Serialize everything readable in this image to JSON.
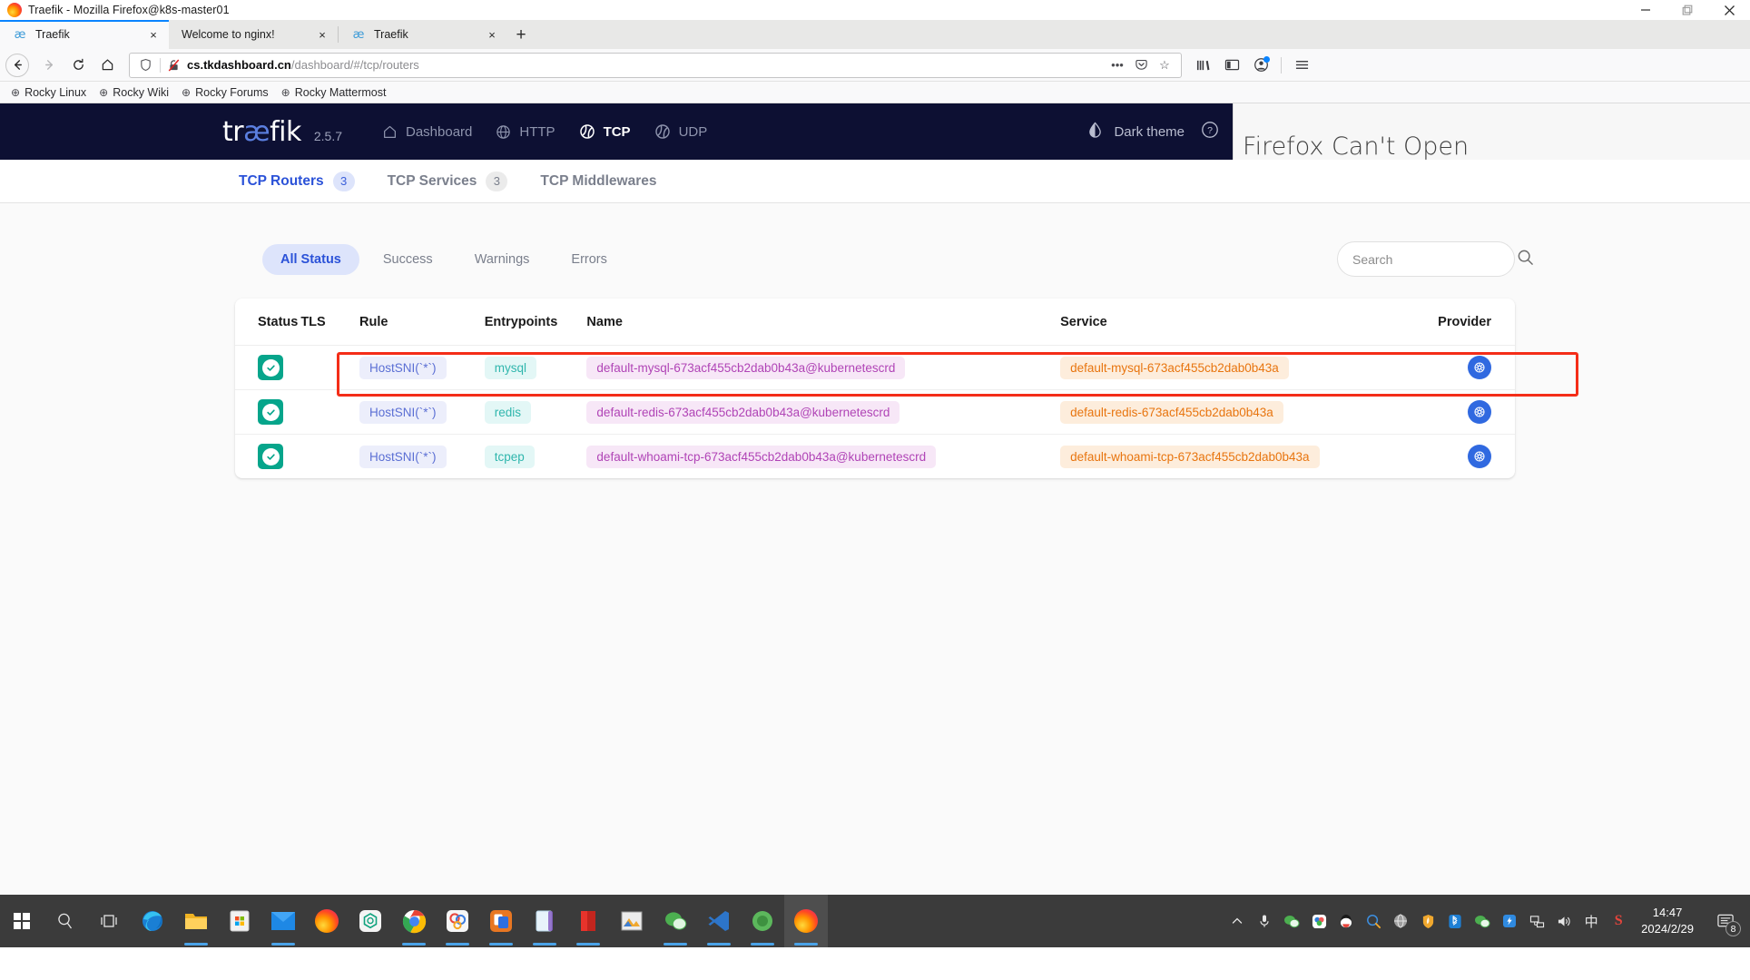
{
  "window": {
    "title": "Traefik - Mozilla Firefox@k8s-master01",
    "controls": {
      "minimize": "minimize-icon",
      "maximize": "restore-icon",
      "close": "close-icon"
    }
  },
  "tabs": [
    {
      "title": "Traefik",
      "favicon": "traefik-ae-icon",
      "active": true,
      "close": "×"
    },
    {
      "title": "Welcome to nginx!",
      "favicon": "",
      "active": false,
      "close": "×"
    },
    {
      "title": "Traefik",
      "favicon": "traefik-ae-icon",
      "active": false,
      "close": "×"
    }
  ],
  "newtab_label": "+",
  "toolbar": {
    "back": "back-icon",
    "forward": "forward-icon",
    "reload": "reload-icon",
    "home": "home-icon",
    "url_host": "cs.tkdashboard.cn",
    "url_path": "/dashboard/#/tcp/routers",
    "url_prefix": "",
    "page_actions": "•••",
    "pocket": "pocket-icon",
    "bookmark_star": "☆",
    "library": "library-icon",
    "sidebar": "sidebar-icon",
    "account": "account-icon",
    "menu": "hamburger-menu-icon"
  },
  "bookmarks": [
    {
      "label": "Rocky Linux",
      "icon": "⊕"
    },
    {
      "label": "Rocky Wiki",
      "icon": "⊕"
    },
    {
      "label": "Rocky Forums",
      "icon": "⊕"
    },
    {
      "label": "Rocky Mattermost",
      "icon": "⊕"
    }
  ],
  "traefik": {
    "logo_prefix": "tr",
    "logo_ae": "æ",
    "logo_suffix": "fik",
    "version": "2.5.7",
    "nav": [
      {
        "label": "Dashboard",
        "icon": "home-icon",
        "active": false
      },
      {
        "label": "HTTP",
        "icon": "globe-icon",
        "active": false
      },
      {
        "label": "TCP",
        "icon": "tcp-icon",
        "active": true
      },
      {
        "label": "UDP",
        "icon": "udp-icon",
        "active": false
      }
    ],
    "theme_label": "Dark theme",
    "help_label": "?",
    "subtabs": [
      {
        "label": "TCP Routers",
        "count": "3",
        "active": true
      },
      {
        "label": "TCP Services",
        "count": "3",
        "active": false
      },
      {
        "label": "TCP Middlewares",
        "count": "",
        "active": false
      }
    ],
    "status_filters": [
      {
        "label": "All Status",
        "active": true
      },
      {
        "label": "Success",
        "active": false
      },
      {
        "label": "Warnings",
        "active": false
      },
      {
        "label": "Errors",
        "active": false
      }
    ],
    "search": {
      "placeholder": "Search",
      "value": ""
    },
    "table": {
      "headers": [
        "Status",
        "TLS",
        "Rule",
        "Entrypoints",
        "Name",
        "Service",
        "Provider"
      ],
      "rows": [
        {
          "status": "success",
          "tls": "",
          "rule": "HostSNI(`*`)",
          "entrypoints": "mysql",
          "name": "default-mysql-673acf455cb2dab0b43a@kubernetescrd",
          "service": "default-mysql-673acf455cb2dab0b43a",
          "provider": "kubernetes-icon",
          "highlighted": false
        },
        {
          "status": "success",
          "tls": "",
          "rule": "HostSNI(`*`)",
          "entrypoints": "redis",
          "name": "default-redis-673acf455cb2dab0b43a@kubernetescrd",
          "service": "default-redis-673acf455cb2dab0b43a",
          "provider": "kubernetes-icon",
          "highlighted": true
        },
        {
          "status": "success",
          "tls": "",
          "rule": "HostSNI(`*`)",
          "entrypoints": "tcpep",
          "name": "default-whoami-tcp-673acf455cb2dab0b43a@kubernetescrd",
          "service": "default-whoami-tcp-673acf455cb2dab0b43a",
          "provider": "kubernetes-icon",
          "highlighted": false
        }
      ]
    }
  },
  "firefox_overlay": {
    "text": "Firefox Can't Open"
  },
  "taskbar": {
    "start": "windows-start-icon",
    "search": "search-icon",
    "taskview": "task-view-icon",
    "apps": [
      {
        "name": "microsoft-edge",
        "running": false
      },
      {
        "name": "file-explorer",
        "running": true
      },
      {
        "name": "microsoft-store",
        "running": false
      },
      {
        "name": "mail",
        "running": true
      },
      {
        "name": "firefox",
        "running": false
      },
      {
        "name": "chatgpt",
        "running": false
      },
      {
        "name": "google-chrome",
        "running": true
      },
      {
        "name": "xmind",
        "running": true
      },
      {
        "name": "copy-translator",
        "running": true
      },
      {
        "name": "onenote",
        "running": true
      },
      {
        "name": "pdf-reader",
        "running": true
      },
      {
        "name": "snipaste",
        "running": false
      },
      {
        "name": "wechat",
        "running": true
      },
      {
        "name": "vscode",
        "running": true
      },
      {
        "name": "xshell",
        "running": true
      },
      {
        "name": "firefox-active",
        "running": true
      }
    ],
    "tray": [
      {
        "name": "show-hidden-icons",
        "glyph": "∧"
      },
      {
        "name": "microphone-icon",
        "glyph": "🎤"
      },
      {
        "name": "wechat-tray-icon",
        "glyph": ""
      },
      {
        "name": "cloud-sync-icon",
        "glyph": ""
      },
      {
        "name": "qq-icon",
        "glyph": ""
      },
      {
        "name": "search-tool-icon",
        "glyph": ""
      },
      {
        "name": "globe-tray-icon",
        "glyph": ""
      },
      {
        "name": "security-shield-icon",
        "glyph": ""
      },
      {
        "name": "bluetooth-icon",
        "glyph": ""
      },
      {
        "name": "wechat-work-icon",
        "glyph": ""
      },
      {
        "name": "dingtalk-icon",
        "glyph": ""
      },
      {
        "name": "network-icon",
        "glyph": ""
      },
      {
        "name": "volume-icon",
        "glyph": "🔊"
      },
      {
        "name": "ime-icon",
        "glyph": "中"
      },
      {
        "name": "sogou-icon",
        "glyph": "S"
      }
    ],
    "clock": {
      "time": "14:47",
      "date": "2024/2/29"
    },
    "notifications": {
      "icon": "action-center-icon",
      "count": "8"
    }
  }
}
